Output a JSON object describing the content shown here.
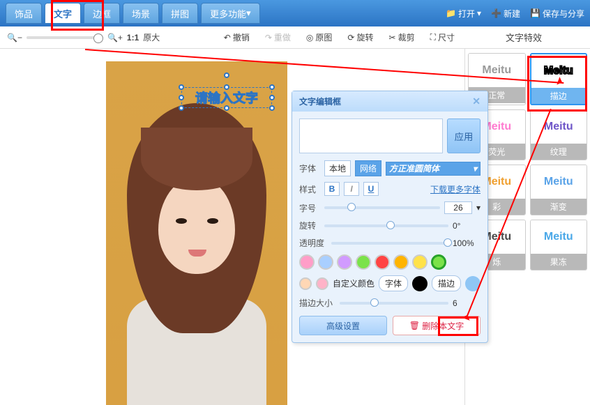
{
  "tabs": {
    "t0": "饰品",
    "t1": "文字",
    "t2": "边框",
    "t3": "场景",
    "t4": "拼图",
    "t5": "更多功能"
  },
  "topright": {
    "open": "打开",
    "new": "新建",
    "save": "保存与分享"
  },
  "toolbar": {
    "ratio": "1:1",
    "orig": "原大",
    "undo": "撤销",
    "redo": "重做",
    "origimg": "原图",
    "rotate": "旋转",
    "crop": "裁剪",
    "size": "尺寸"
  },
  "side_title": "文字特效",
  "effects": [
    {
      "label": "正常",
      "color": "#9a9a9a"
    },
    {
      "label": "描边",
      "color": "#000000",
      "outline": true
    },
    {
      "label": "荧光",
      "color": "#ff7bd0"
    },
    {
      "label": "纹理",
      "color": "#6f56c8"
    },
    {
      "label": "彩",
      "color": "#f0a030"
    },
    {
      "label": "渐变",
      "color": "#5aa3e8"
    },
    {
      "label": "烁",
      "color": "#4a4a4a"
    },
    {
      "label": "果冻",
      "color": "#4aa8e8"
    }
  ],
  "effect_text": "Meitu",
  "textbox": {
    "placeholder": "请输入文字"
  },
  "popup": {
    "title": "文字编辑框",
    "apply": "应用",
    "font": "字体",
    "font_source_local": "本地",
    "font_source_net": "网络",
    "font_name": "方正准圆简体",
    "style": "样式",
    "more_fonts": "下载更多字体",
    "size": "字号",
    "size_val": "26",
    "rotate": "旋转",
    "rotate_val": "0°",
    "opacity": "透明度",
    "opacity_val": "100%",
    "custom_color": "自定义颜色",
    "chip_font": "字体",
    "chip_stroke": "描边",
    "stroke_size": "描边大小",
    "stroke_val": "6",
    "advanced": "高级设置",
    "delete": "删除本文字",
    "swatches": [
      "#ff9ec8",
      "#a9cfff",
      "#d19bff",
      "#7be24a",
      "#ff4444",
      "#ffb400",
      "#ffe24a",
      "#7be24a"
    ],
    "small_swatches": [
      "#ffd7b5",
      "#ffb3c8"
    ],
    "font_dot": "#000000",
    "stroke_dot": "#8fc6f5"
  }
}
